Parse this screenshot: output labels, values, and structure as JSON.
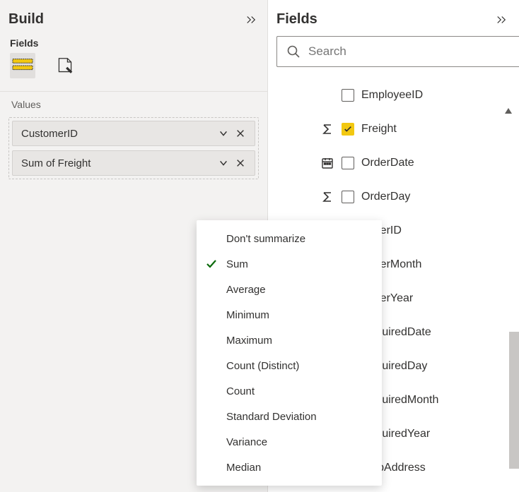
{
  "build": {
    "title": "Build",
    "fields_label": "Fields",
    "values_label": "Values",
    "value_pills": [
      {
        "label": "CustomerID"
      },
      {
        "label": "Sum of Freight"
      }
    ]
  },
  "agg_menu": {
    "selected_index": 1,
    "options": [
      "Don't summarize",
      "Sum",
      "Average",
      "Minimum",
      "Maximum",
      "Count (Distinct)",
      "Count",
      "Standard Deviation",
      "Variance",
      "Median"
    ]
  },
  "fields_pane": {
    "title": "Fields",
    "search_placeholder": "Search",
    "items": [
      {
        "label": "EmployeeID",
        "checked": false,
        "icon": "none"
      },
      {
        "label": "Freight",
        "checked": true,
        "icon": "sigma"
      },
      {
        "label": "OrderDate",
        "checked": false,
        "icon": "calendar"
      },
      {
        "label": "OrderDay",
        "checked": false,
        "icon": "sigma"
      },
      {
        "label": "OrderID",
        "checked": false,
        "icon": "none"
      },
      {
        "label": "OrderMonth",
        "checked": false,
        "icon": "none"
      },
      {
        "label": "OrderYear",
        "checked": false,
        "icon": "none"
      },
      {
        "label": "RequiredDate",
        "checked": false,
        "icon": "none"
      },
      {
        "label": "RequiredDay",
        "checked": false,
        "icon": "none"
      },
      {
        "label": "RequiredMonth",
        "checked": false,
        "icon": "none"
      },
      {
        "label": "RequiredYear",
        "checked": false,
        "icon": "none"
      },
      {
        "label": "ShipAddress",
        "checked": false,
        "icon": "none"
      }
    ]
  }
}
